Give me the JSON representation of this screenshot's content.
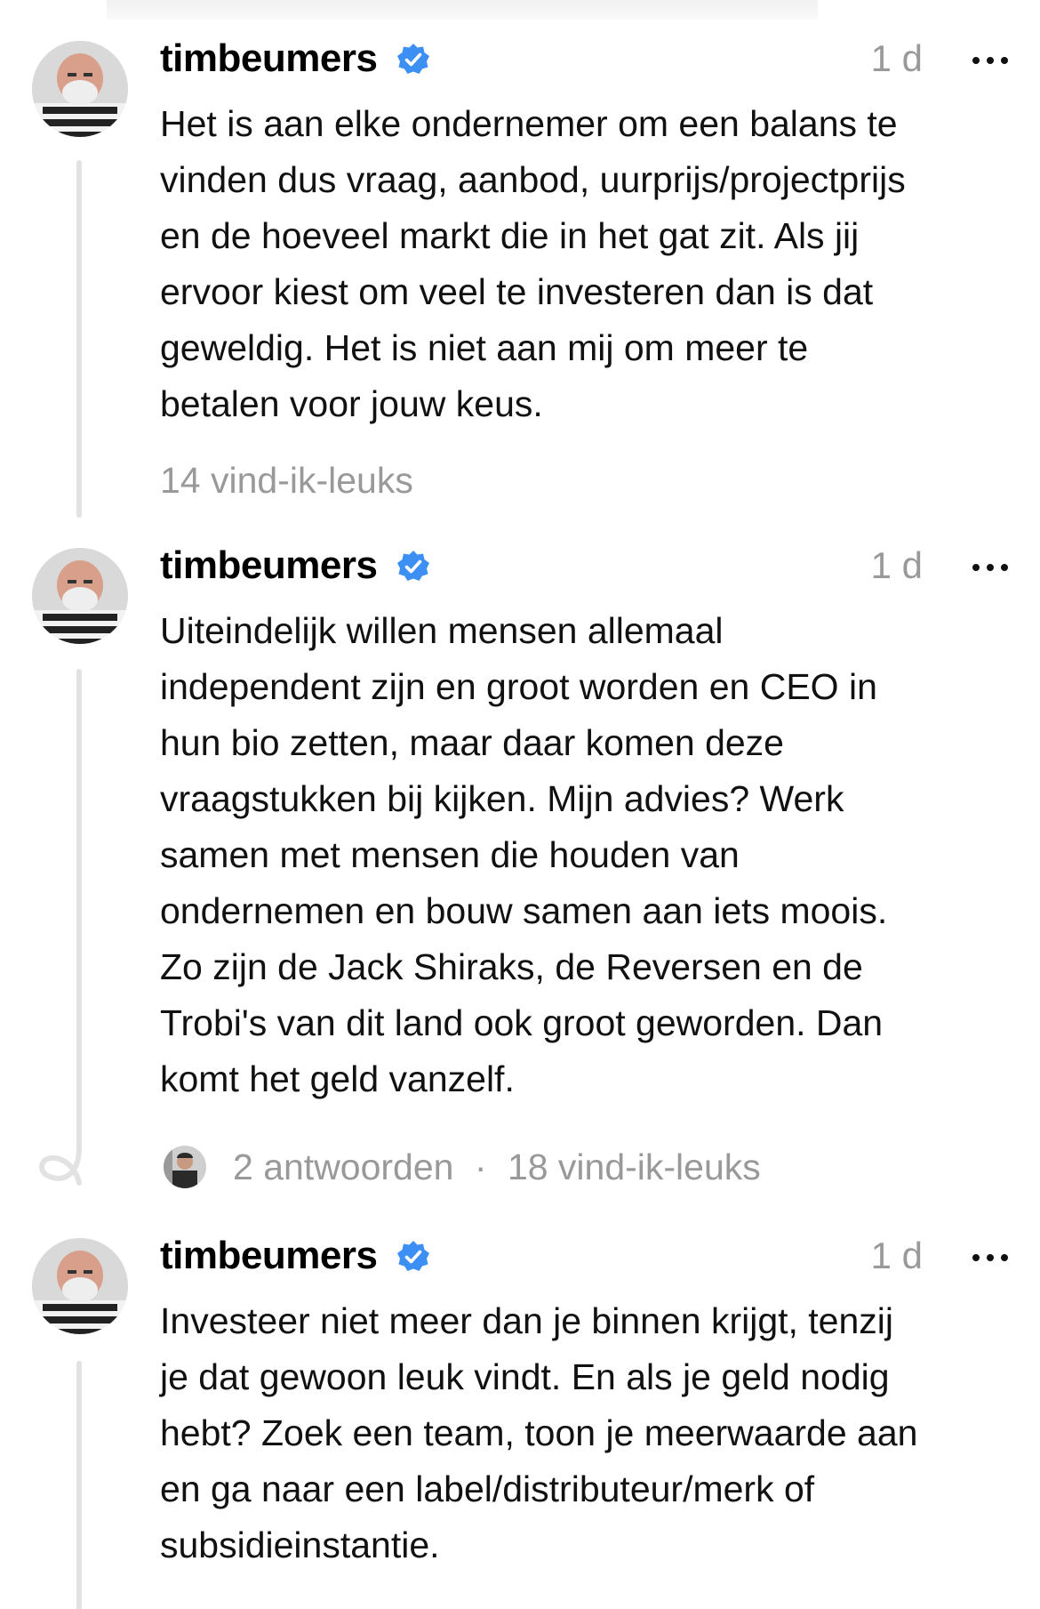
{
  "posts": [
    {
      "username": "timbeumers",
      "verified": true,
      "time": "1 d",
      "text": "Het is aan elke ondernemer om een balans te\nvinden dus vraag, aanbod, uurprijs/projectprijs\nen de hoeveel markt die in het gat zit. Als jij\nervoor kiest om veel te investeren dan is dat\ngeweldig. Het is niet aan mij om meer te\nbetalen voor jouw keus.",
      "likes": "14 vind-ik-leuks"
    },
    {
      "username": "timbeumers",
      "verified": true,
      "time": "1 d",
      "text": "Uiteindelijk willen mensen allemaal\nindependent zijn en groot worden en CEO in\nhun bio zetten, maar daar komen deze\nvraagstukken bij kijken. Mijn advies? Werk\nsamen met mensen die houden van\nondernemen en bouw samen aan iets moois.\nZo zijn de Jack Shiraks, de Reversen en de\nTrobi's van dit land ook groot geworden. Dan\nkomt het geld vanzelf.",
      "replies": "2 antwoorden",
      "separator": "·",
      "likes": "18 vind-ik-leuks"
    },
    {
      "username": "timbeumers",
      "verified": true,
      "time": "1 d",
      "text": "Investeer niet meer dan je binnen krijgt, tenzij\nje dat gewoon leuk vindt. En als je geld nodig\nhebt? Zoek een team, toon je meerwaarde aan\nen ga naar een label/distributeur/merk of\nsubsidieinstantie."
    }
  ],
  "icons": {
    "verified": "verified-badge-icon",
    "more": "more-options-icon",
    "avatar": "profile-avatar",
    "thread": "thread-line"
  },
  "colors": {
    "verified_blue": "#3d90f3",
    "muted_text": "#999999",
    "thread_line": "#e2e2e2"
  }
}
